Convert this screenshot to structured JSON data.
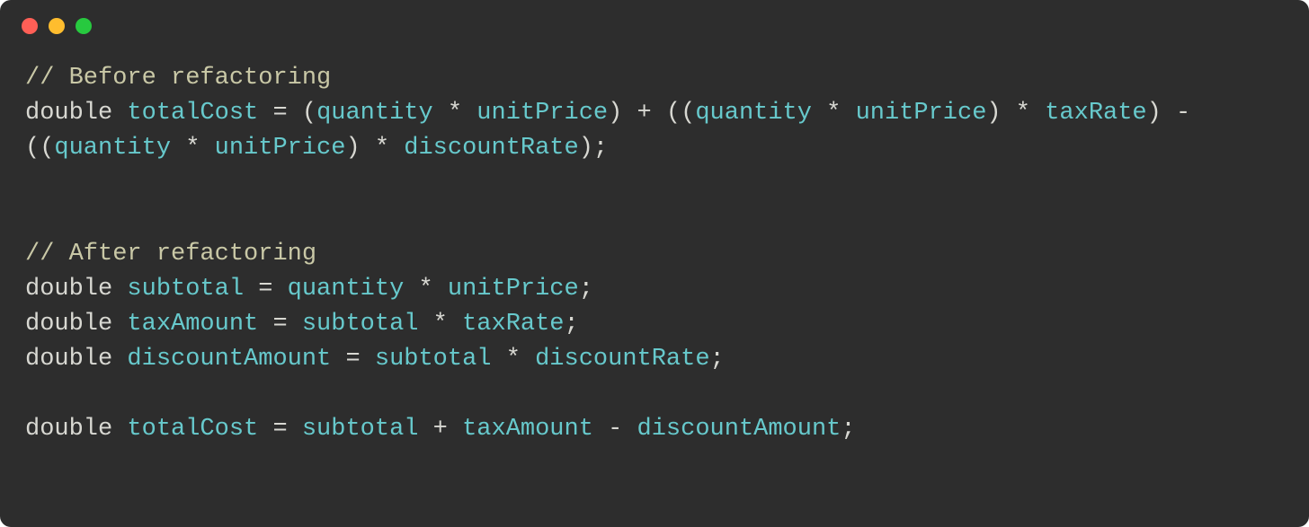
{
  "window": {
    "controls": [
      "close",
      "minimize",
      "maximize"
    ]
  },
  "code": {
    "lines": [
      {
        "type": "comment",
        "tokens": [
          {
            "cls": "comment",
            "t": "// Before refactoring"
          }
        ]
      },
      {
        "type": "code",
        "tokens": [
          {
            "cls": "keyword",
            "t": "double "
          },
          {
            "cls": "ident",
            "t": "totalCost"
          },
          {
            "cls": "op",
            "t": " = ("
          },
          {
            "cls": "ident",
            "t": "quantity"
          },
          {
            "cls": "op",
            "t": " * "
          },
          {
            "cls": "ident",
            "t": "unitPrice"
          },
          {
            "cls": "op",
            "t": ") + (("
          },
          {
            "cls": "ident",
            "t": "quantity"
          },
          {
            "cls": "op",
            "t": " * "
          },
          {
            "cls": "ident",
            "t": "unitPrice"
          },
          {
            "cls": "op",
            "t": ") * "
          },
          {
            "cls": "ident",
            "t": "taxRate"
          },
          {
            "cls": "op",
            "t": ") - (("
          },
          {
            "cls": "ident",
            "t": "quantity"
          },
          {
            "cls": "op",
            "t": " * "
          },
          {
            "cls": "ident",
            "t": "unitPrice"
          },
          {
            "cls": "op",
            "t": ") * "
          },
          {
            "cls": "ident",
            "t": "discountRate"
          },
          {
            "cls": "punct",
            "t": ");"
          }
        ]
      },
      {
        "type": "blank"
      },
      {
        "type": "blank"
      },
      {
        "type": "comment",
        "tokens": [
          {
            "cls": "comment",
            "t": "// After refactoring"
          }
        ]
      },
      {
        "type": "code",
        "tokens": [
          {
            "cls": "keyword",
            "t": "double "
          },
          {
            "cls": "ident",
            "t": "subtotal"
          },
          {
            "cls": "op",
            "t": " = "
          },
          {
            "cls": "ident",
            "t": "quantity"
          },
          {
            "cls": "op",
            "t": " * "
          },
          {
            "cls": "ident",
            "t": "unitPrice"
          },
          {
            "cls": "punct",
            "t": ";"
          }
        ]
      },
      {
        "type": "code",
        "tokens": [
          {
            "cls": "keyword",
            "t": "double "
          },
          {
            "cls": "ident",
            "t": "taxAmount"
          },
          {
            "cls": "op",
            "t": " = "
          },
          {
            "cls": "ident",
            "t": "subtotal"
          },
          {
            "cls": "op",
            "t": " * "
          },
          {
            "cls": "ident",
            "t": "taxRate"
          },
          {
            "cls": "punct",
            "t": ";"
          }
        ]
      },
      {
        "type": "code",
        "tokens": [
          {
            "cls": "keyword",
            "t": "double "
          },
          {
            "cls": "ident",
            "t": "discountAmount"
          },
          {
            "cls": "op",
            "t": " = "
          },
          {
            "cls": "ident",
            "t": "subtotal"
          },
          {
            "cls": "op",
            "t": " * "
          },
          {
            "cls": "ident",
            "t": "discountRate"
          },
          {
            "cls": "punct",
            "t": ";"
          }
        ]
      },
      {
        "type": "blank"
      },
      {
        "type": "code",
        "tokens": [
          {
            "cls": "keyword",
            "t": "double "
          },
          {
            "cls": "ident",
            "t": "totalCost"
          },
          {
            "cls": "op",
            "t": " = "
          },
          {
            "cls": "ident",
            "t": "subtotal"
          },
          {
            "cls": "op",
            "t": " + "
          },
          {
            "cls": "ident",
            "t": "taxAmount"
          },
          {
            "cls": "op",
            "t": " - "
          },
          {
            "cls": "ident",
            "t": "discountAmount"
          },
          {
            "cls": "punct",
            "t": ";"
          }
        ]
      }
    ]
  }
}
